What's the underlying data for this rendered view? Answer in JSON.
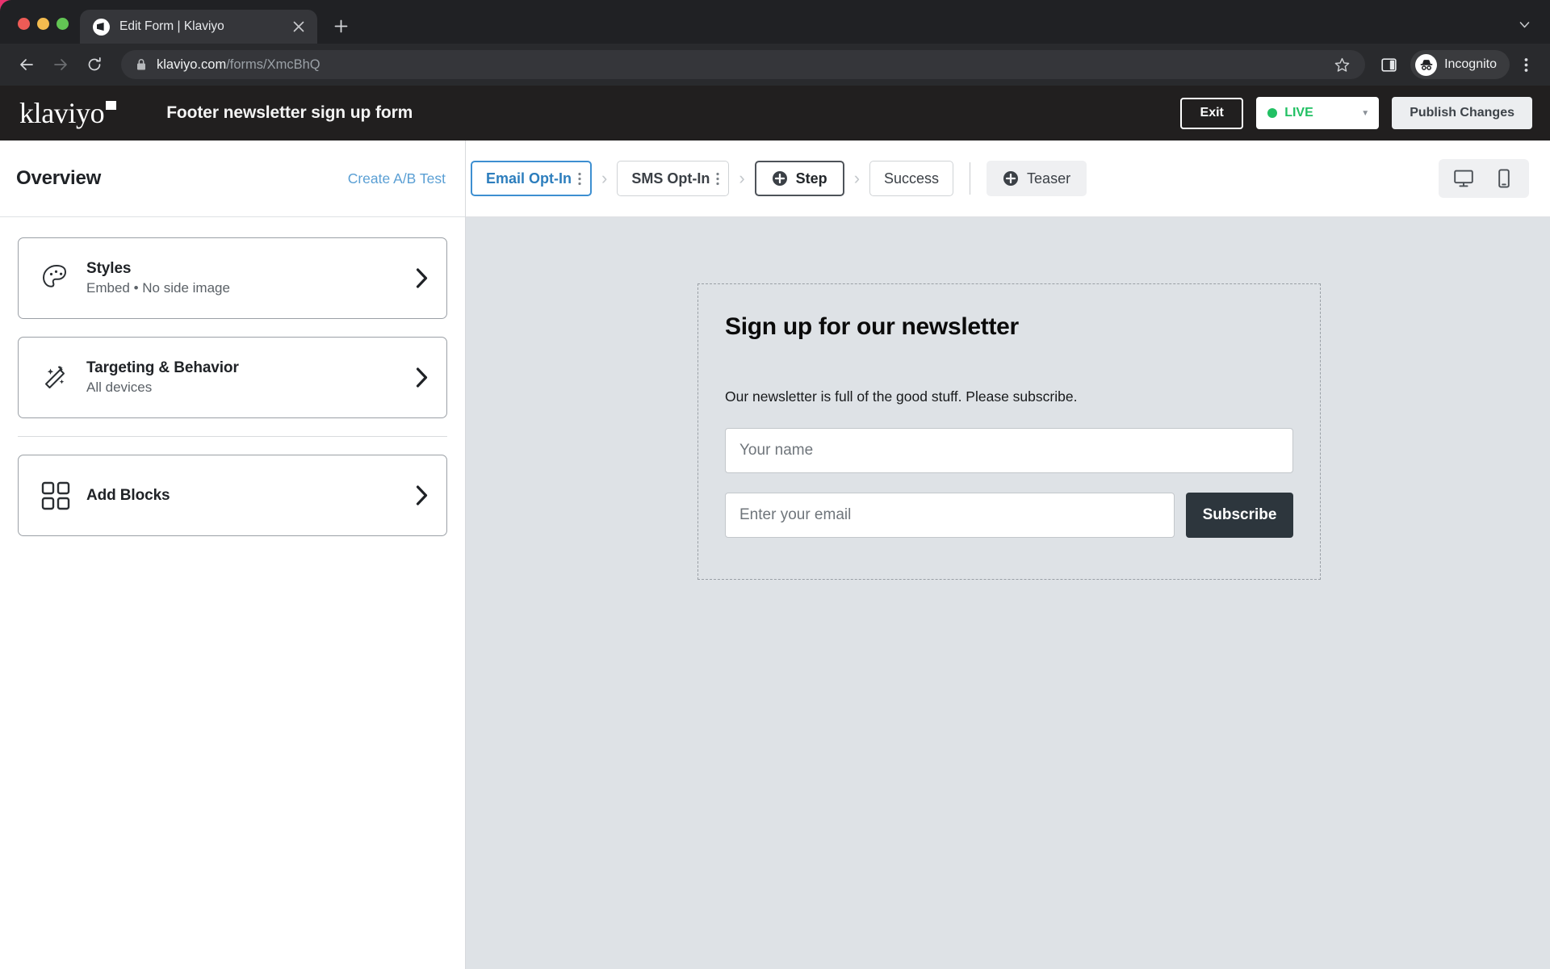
{
  "browser": {
    "tab": {
      "title": "Edit Form | Klaviyo",
      "favicon": "klaviyo-favicon-icon",
      "close": "close-icon"
    },
    "new_tab": "+",
    "tabstrip_menu": "chevron-down-icon",
    "nav": {
      "back": "back-arrow-icon",
      "forward": "forward-arrow-icon",
      "reload": "reload-icon"
    },
    "omnibox": {
      "lock": "lock-icon",
      "url_host": "klaviyo.com",
      "url_path": "/forms/XmcBhQ",
      "bookmark": "star-icon"
    },
    "side_panel": "side-panel-icon",
    "profile": {
      "label": "Incognito",
      "avatar": "incognito-avatar-icon"
    },
    "menu": "kebab-menu-icon"
  },
  "appbar": {
    "logo_text": "klaviyo",
    "form_name": "Footer newsletter sign up form",
    "exit_label": "Exit",
    "status": {
      "label": "LIVE",
      "color": "#21c063",
      "caret": "caret-down-icon"
    },
    "publish_label": "Publish Changes"
  },
  "sidebar": {
    "title": "Overview",
    "ab_test_link": "Create A/B Test",
    "cards": [
      {
        "icon": "palette-icon",
        "title": "Styles",
        "subtitle": "Embed • No side image",
        "chevron": "chevron-right-icon"
      },
      {
        "icon": "magic-wand-icon",
        "title": "Targeting & Behavior",
        "subtitle": "All devices",
        "chevron": "chevron-right-icon"
      },
      {
        "icon": "blocks-grid-icon",
        "title": "Add Blocks",
        "subtitle": "",
        "chevron": "chevron-right-icon"
      }
    ]
  },
  "stepbar": {
    "steps": [
      {
        "label": "Email Opt-In",
        "state": "active",
        "menu": "kebab-menu-icon"
      },
      {
        "label": "SMS Opt-In",
        "state": "default",
        "menu": "kebab-menu-icon"
      },
      {
        "label": "Step",
        "state": "add",
        "icon": "plus-circle-icon"
      },
      {
        "label": "Success",
        "state": "plain"
      }
    ],
    "separator": "›",
    "teaser": {
      "label": "Teaser",
      "icon": "plus-circle-icon"
    },
    "devices": [
      {
        "name": "desktop-icon",
        "selected": true
      },
      {
        "name": "mobile-icon",
        "selected": false
      }
    ]
  },
  "preview": {
    "heading": "Sign up for our newsletter",
    "subtext": "Our newsletter is full of the good stuff. Please subscribe.",
    "name_placeholder": "Your name",
    "email_placeholder": "Enter your email",
    "submit_label": "Subscribe",
    "submit_color": "#2d363d",
    "canvas_color": "#dee2e6"
  }
}
